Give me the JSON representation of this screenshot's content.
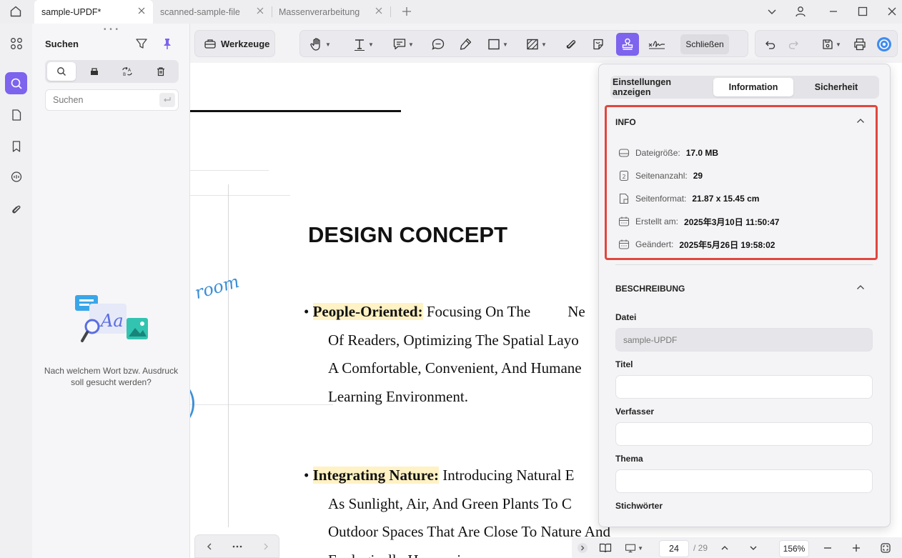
{
  "tabs": [
    {
      "label": "sample-UPDF*"
    },
    {
      "label": "scanned-sample-file"
    },
    {
      "label": "Massenverarbeitung"
    }
  ],
  "search_panel": {
    "title": "Suchen",
    "placeholder": "Suchen",
    "empty_text": "Nach welchem Wort bzw. Ausdruck soll gesucht werden?"
  },
  "toolbar": {
    "tools_label": "Werkzeuge",
    "close_label": "Schließen"
  },
  "document": {
    "title": "DESIGN CONCEPT",
    "script_word": "room",
    "bullet1": {
      "heading": "People-Oriented:",
      "line1_rest": " Focusing On The",
      "line1_tail": "Ne",
      "line2": "Of Readers, Optimizing The Spatial Layo",
      "line3": "A Comfortable, Convenient, And Humane",
      "line4": "Learning Environment."
    },
    "bullet2": {
      "heading": "Integrating Nature:",
      "line1_rest": " Introducing Natural E",
      "line2": "As Sunlight, Air, And Green Plants To C",
      "line3": "Outdoor Spaces That Are Close To Nature And",
      "line4": "Ecologically Harmonious"
    }
  },
  "properties": {
    "tabs": [
      "Einstellungen anzeigen",
      "Information",
      "Sicherheit"
    ],
    "active_tab": "Information",
    "info_heading": "INFO",
    "info_rows": [
      {
        "label": "Dateigröße:",
        "value": "17.0 MB",
        "icon": "drive-icon"
      },
      {
        "label": "Seitenanzahl:",
        "value": "29",
        "icon": "page-count-icon"
      },
      {
        "label": "Seitenformat:",
        "value": "21.87 x 15.45 cm",
        "icon": "page-format-icon"
      },
      {
        "label": "Erstellt am:",
        "value": "2025年3月10日 11:50:47",
        "icon": "calendar-icon"
      },
      {
        "label": "Geändert:",
        "value": "2025年5月26日 19:58:02",
        "icon": "calendar-icon"
      }
    ],
    "desc_heading": "BESCHREIBUNG",
    "fields": [
      {
        "label": "Datei",
        "value": "sample-UPDF",
        "readonly": true
      },
      {
        "label": "Titel",
        "value": ""
      },
      {
        "label": "Verfasser",
        "value": ""
      },
      {
        "label": "Thema",
        "value": ""
      },
      {
        "label": "Stichwörter",
        "value": ""
      }
    ]
  },
  "status": {
    "current_page": "24",
    "total_pages": "/ 29",
    "zoom": "156%"
  },
  "colors": {
    "accent": "#7d63ee",
    "highlight": "#fff2c4",
    "info_border": "#e0473f"
  }
}
